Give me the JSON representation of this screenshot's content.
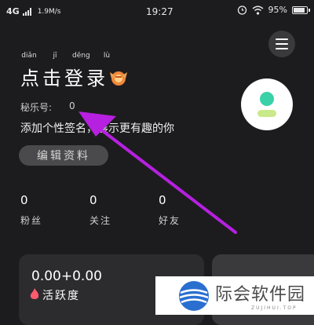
{
  "status_bar": {
    "network": "4G",
    "speed": "1.9M/s",
    "time": "19:27",
    "battery": "95%",
    "battery_level": 0.95
  },
  "header": {
    "pinyin": [
      "diǎn",
      "jī",
      "dēng",
      "lù"
    ],
    "login_title": "点击登录",
    "account_label": "秘乐号:",
    "account_value": "0",
    "signature": "添加个性签名，展示更有趣的你",
    "edit_button": "编辑资料"
  },
  "stats": [
    {
      "value": "0",
      "label": "粉丝"
    },
    {
      "value": "0",
      "label": "关注"
    },
    {
      "value": "0",
      "label": "好友"
    }
  ],
  "activity_card": {
    "value": "0.00+0.00",
    "label": "活跃度"
  },
  "watermark": {
    "name": "际会软件园",
    "sub": "ZUJIHUI.TOP"
  },
  "colors": {
    "background": "#1c1c1e",
    "annotation_arrow": "#b620e0",
    "avatar_accent": "#3ad1a8",
    "flame": "#ff5a6e"
  },
  "icons": [
    "menu-icon",
    "badge-icon",
    "avatar-icon",
    "flame-icon",
    "wifi-icon",
    "alarm-icon",
    "battery-icon",
    "signal-icon"
  ]
}
